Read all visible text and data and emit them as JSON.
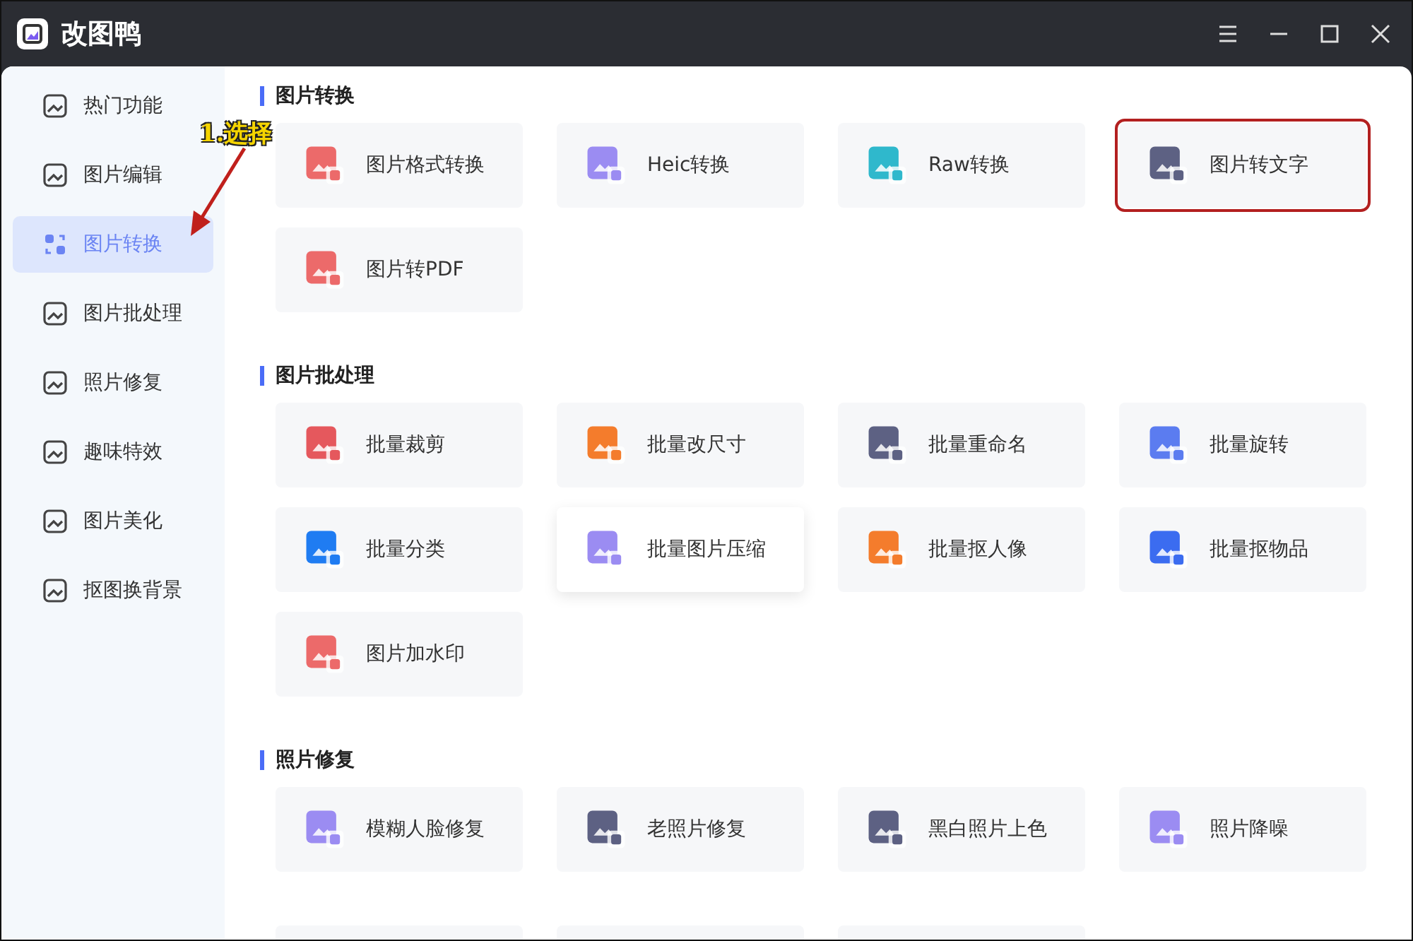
{
  "window": {
    "title": "改图鸭"
  },
  "sidebar": {
    "items": [
      {
        "label": "热门功能",
        "selected": false
      },
      {
        "label": "图片编辑",
        "selected": false
      },
      {
        "label": "图片转换",
        "selected": true
      },
      {
        "label": "图片批处理",
        "selected": false
      },
      {
        "label": "照片修复",
        "selected": false
      },
      {
        "label": "趣味特效",
        "selected": false
      },
      {
        "label": "图片美化",
        "selected": false
      },
      {
        "label": "抠图换背景",
        "selected": false
      }
    ]
  },
  "annotation": {
    "text": "1.选择"
  },
  "sections": [
    {
      "title": "图片转换",
      "tools": [
        {
          "label": "图片格式转换",
          "color": "#ec6a6a",
          "hovered": false,
          "highlighted": false
        },
        {
          "label": "Heic转换",
          "color": "#9b8cf2",
          "hovered": false,
          "highlighted": false
        },
        {
          "label": "Raw转换",
          "color": "#2fb8cc",
          "hovered": false,
          "highlighted": false
        },
        {
          "label": "图片转文字",
          "color": "#5d6183",
          "hovered": false,
          "highlighted": true
        },
        {
          "label": "图片转PDF",
          "color": "#ec6a6a",
          "hovered": false,
          "highlighted": false
        }
      ]
    },
    {
      "title": "图片批处理",
      "tools": [
        {
          "label": "批量裁剪",
          "color": "#e5585d",
          "hovered": false,
          "highlighted": false
        },
        {
          "label": "批量改尺寸",
          "color": "#f47c2c",
          "hovered": false,
          "highlighted": false
        },
        {
          "label": "批量重命名",
          "color": "#5d6183",
          "hovered": false,
          "highlighted": false
        },
        {
          "label": "批量旋转",
          "color": "#5b7cf0",
          "hovered": false,
          "highlighted": false
        },
        {
          "label": "批量分类",
          "color": "#1f7cf2",
          "hovered": false,
          "highlighted": false
        },
        {
          "label": "批量图片压缩",
          "color": "#9b8cf2",
          "hovered": true,
          "highlighted": false
        },
        {
          "label": "批量抠人像",
          "color": "#f47c2c",
          "hovered": false,
          "highlighted": false
        },
        {
          "label": "批量抠物品",
          "color": "#3b6cf0",
          "hovered": false,
          "highlighted": false
        },
        {
          "label": "图片加水印",
          "color": "#ec6a6a",
          "hovered": false,
          "highlighted": false
        }
      ]
    },
    {
      "title": "照片修复",
      "tools": [
        {
          "label": "模糊人脸修复",
          "color": "#9b8cf2",
          "hovered": false,
          "highlighted": false
        },
        {
          "label": "老照片修复",
          "color": "#5d6183",
          "hovered": false,
          "highlighted": false
        },
        {
          "label": "黑白照片上色",
          "color": "#5d6183",
          "hovered": false,
          "highlighted": false
        },
        {
          "label": "照片降噪",
          "color": "#9b8cf2",
          "hovered": false,
          "highlighted": false
        }
      ]
    }
  ]
}
